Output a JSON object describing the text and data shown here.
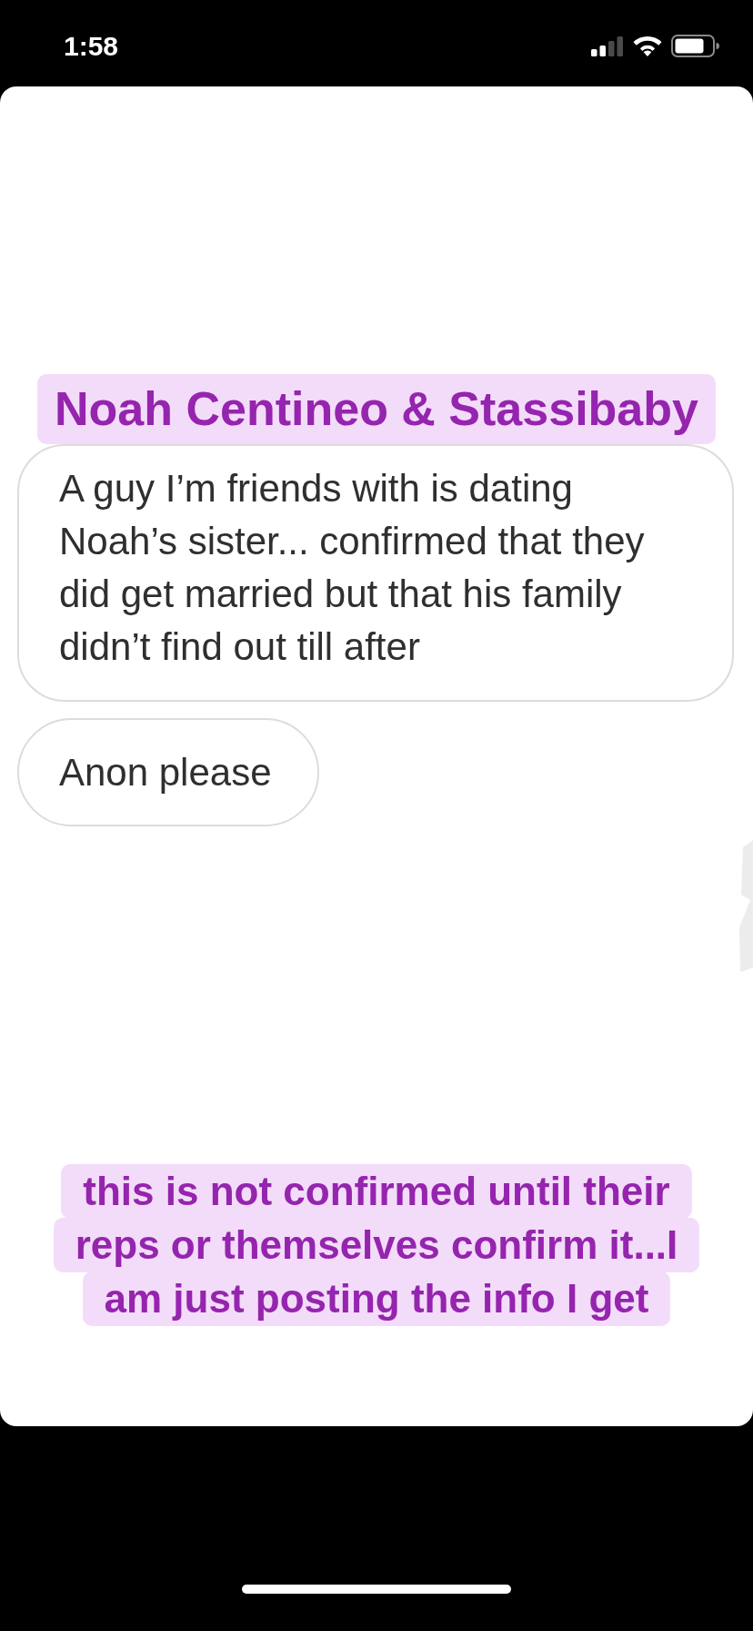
{
  "status_bar": {
    "time": "1:58"
  },
  "story": {
    "title": "Noah Centineo & Stassibaby",
    "messages": [
      {
        "text": "A guy I’m friends with is dating Noah’s sister... confirmed that they did get married but that his family didn’t find out till after"
      },
      {
        "text": "Anon please"
      }
    ],
    "caption_lines": [
      "this is not confirmed until their",
      "reps or themselves confirm it...I",
      "am just posting the info I get"
    ]
  }
}
